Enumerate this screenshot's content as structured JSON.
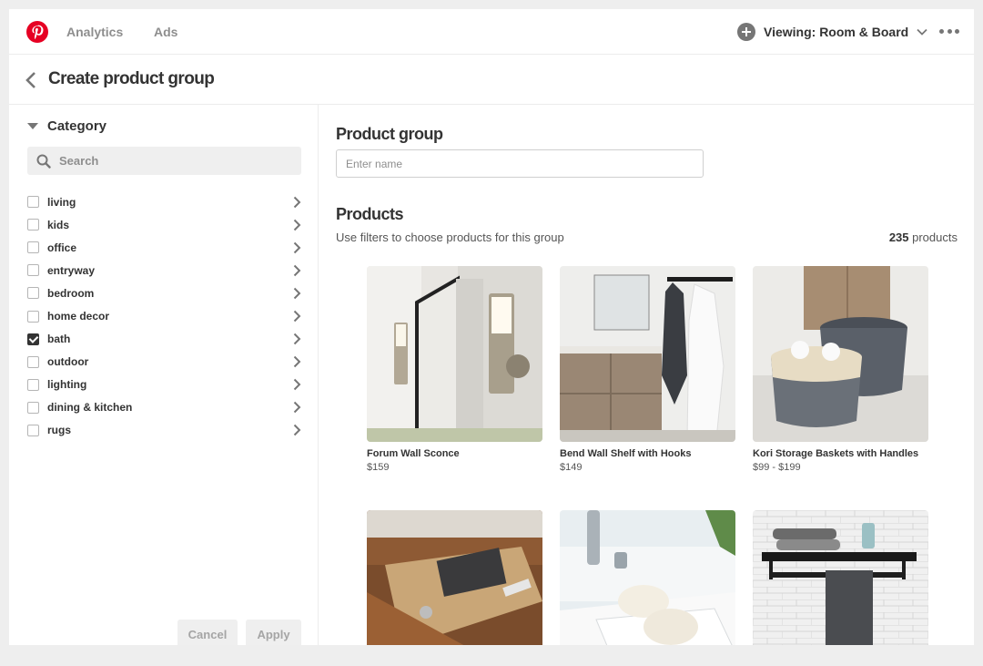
{
  "nav": {
    "links": [
      "Analytics",
      "Ads"
    ],
    "viewing": "Viewing: Room & Board"
  },
  "header": {
    "title": "Create product group"
  },
  "sidebar": {
    "category_title": "Category",
    "search_placeholder": "Search",
    "categories": [
      {
        "label": "living",
        "checked": false
      },
      {
        "label": "kids",
        "checked": false
      },
      {
        "label": "office",
        "checked": false
      },
      {
        "label": "entryway",
        "checked": false
      },
      {
        "label": "bedroom",
        "checked": false
      },
      {
        "label": "home decor",
        "checked": false
      },
      {
        "label": "bath",
        "checked": true
      },
      {
        "label": "outdoor",
        "checked": false
      },
      {
        "label": "lighting",
        "checked": false
      },
      {
        "label": "dining & kitchen",
        "checked": false
      },
      {
        "label": "rugs",
        "checked": false
      }
    ],
    "cancel_label": "Cancel",
    "apply_label": "Apply"
  },
  "main": {
    "product_group_title": "Product group",
    "name_placeholder": "Enter name",
    "products_title": "Products",
    "products_subtitle": "Use filters to choose products for this group",
    "products_count": "235",
    "products_count_suffix": " products",
    "products": [
      {
        "name": "Forum Wall Sconce",
        "price": "$159"
      },
      {
        "name": "Bend Wall Shelf with Hooks",
        "price": "$149"
      },
      {
        "name": "Kori Storage Baskets with Handles",
        "price": "$99 - $199"
      },
      {
        "name": "",
        "price": ""
      },
      {
        "name": "",
        "price": ""
      },
      {
        "name": "",
        "price": ""
      }
    ]
  },
  "colors": {
    "brand": "#e60023",
    "text": "#333333",
    "muted": "#8e8e8e"
  }
}
